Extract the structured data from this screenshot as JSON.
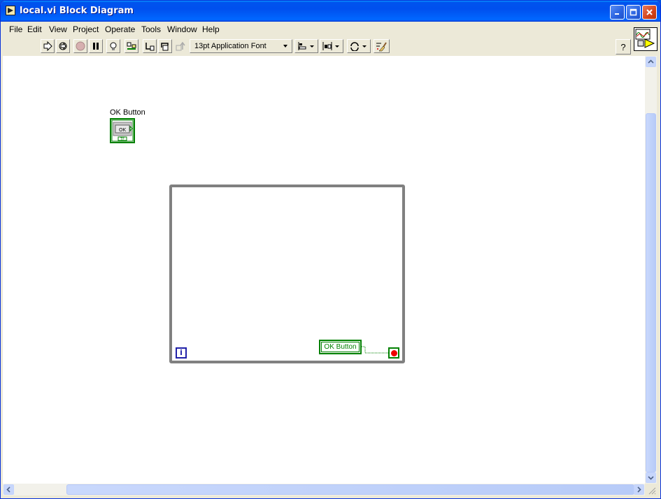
{
  "window": {
    "title": "local.vi Block Diagram"
  },
  "menu": {
    "items": [
      "File",
      "Edit",
      "View",
      "Project",
      "Operate",
      "Tools",
      "Window",
      "Help"
    ]
  },
  "toolbar": {
    "font_ring": "13pt Application Font",
    "help_label": "?",
    "buttons": [
      "run-icon",
      "run-continuously-icon",
      "abort-icon",
      "pause-icon",
      "highlight-execution-icon",
      "retain-wire-values-icon",
      "step-into-icon",
      "step-over-icon",
      "step-out-icon",
      "align-objects-icon",
      "distribute-objects-icon",
      "reorder-icon",
      "clean-up-diagram-icon"
    ]
  },
  "diagram": {
    "terminal_label": "OK Button",
    "terminal_text": "OK",
    "terminal_type": "TF",
    "iteration_label": "i",
    "local_variable_label": "OK Button",
    "colors": {
      "boolean_wire": "#008000",
      "loop_border": "#808080",
      "iteration": "#1f1fa8",
      "stop": "#ee0000"
    }
  }
}
